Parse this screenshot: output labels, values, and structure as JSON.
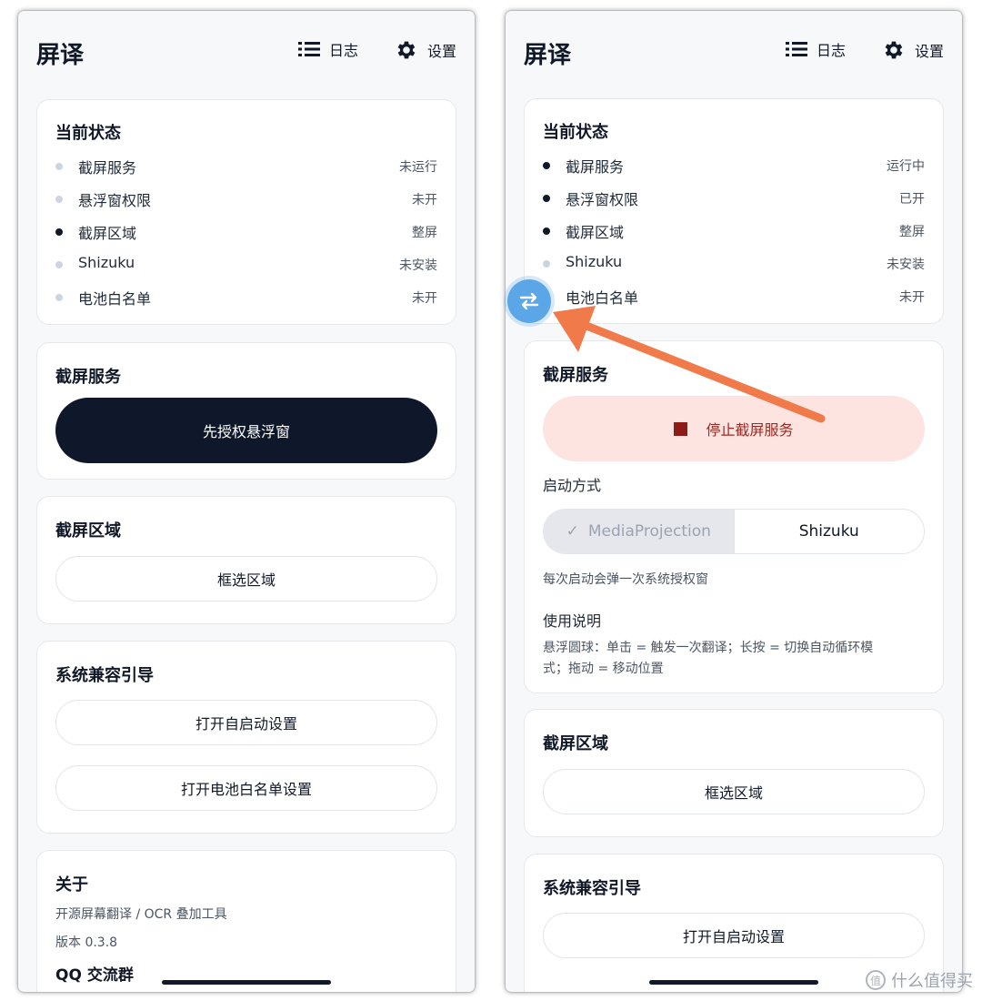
{
  "left": {
    "app_title": "屏译",
    "header": {
      "log_label": "日志",
      "settings_label": "设置"
    },
    "status_card": {
      "title": "当前状态",
      "rows": [
        {
          "name": "截屏服务",
          "value": "未运行"
        },
        {
          "name": "悬浮窗权限",
          "value": "未开"
        },
        {
          "name": "截屏区域",
          "value": "整屏"
        },
        {
          "name": "Shizuku",
          "value": "未安装"
        },
        {
          "name": "电池白名单",
          "value": "未开"
        }
      ]
    },
    "capture_card": {
      "title": "截屏服务",
      "button": "先授权悬浮窗"
    },
    "region_card": {
      "title": "截屏区域",
      "button": "框选区域"
    },
    "compat_card": {
      "title": "系统兼容引导",
      "autostart_button": "打开自启动设置",
      "battery_button": "打开电池白名单设置"
    },
    "about_card": {
      "title": "关于",
      "desc": "开源屏幕翻译 / OCR 叠加工具",
      "version": "版本 0.3.8",
      "qq": "QQ 交流群"
    }
  },
  "right": {
    "app_title": "屏译",
    "header": {
      "log_label": "日志",
      "settings_label": "设置"
    },
    "status_card": {
      "title": "当前状态",
      "rows": [
        {
          "name": "截屏服务",
          "value": "运行中"
        },
        {
          "name": "悬浮窗权限",
          "value": "已开"
        },
        {
          "name": "截屏区域",
          "value": "整屏"
        },
        {
          "name": "Shizuku",
          "value": "未安装"
        },
        {
          "name": "电池白名单",
          "value": "未开"
        }
      ]
    },
    "capture_card": {
      "title": "截屏服务",
      "stop_button": "停止截屏服务",
      "launch_mode_label": "启动方式",
      "modes": [
        "MediaProjection",
        "Shizuku"
      ],
      "check_glyph": "✓",
      "mode_hint": "每次启动会弹一次系统授权窗",
      "usage_label": "使用说明",
      "usage_text_1": "悬浮圆球：单击 = 触发一次翻译；长按 = 切换自动循环模",
      "usage_text_2": "式；拖动 = 移动位置"
    },
    "region_card": {
      "title": "截屏区域",
      "button": "框选区域"
    },
    "compat_card": {
      "title": "系统兼容引导",
      "autostart_button": "打开自启动设置"
    }
  },
  "watermark": {
    "glyph": "值",
    "text": "什么值得买"
  },
  "colors": {
    "primary": "#0f172a",
    "stop_bg": "#fde4e1",
    "stop_fg": "#9a2a22",
    "float_ball": "#5aa6e6",
    "arrow": "#f07a4a"
  },
  "icons": {
    "log": "list-icon",
    "settings": "gear-icon",
    "float_ball": "swap-arrows-icon",
    "annotation": "orange-arrow"
  }
}
